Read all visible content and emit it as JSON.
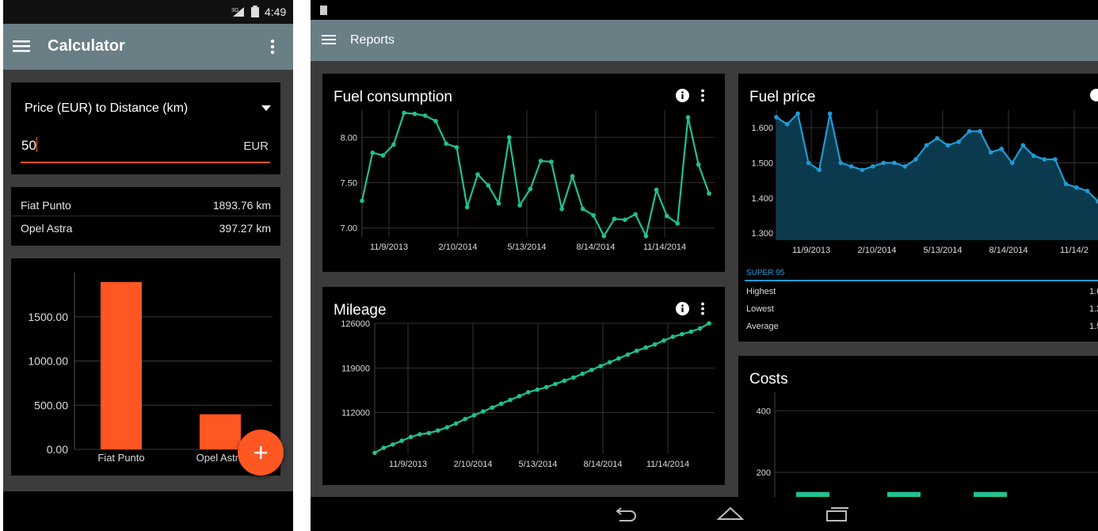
{
  "phone": {
    "status": {
      "network": "3G",
      "time": "4:49"
    },
    "appbar": {
      "title": "Calculator"
    },
    "converter": {
      "mode": "Price (EUR) to Distance (km)",
      "input_value": "50",
      "unit": "EUR"
    },
    "results": [
      {
        "name": "Fiat Punto",
        "value": "1893.76 km"
      },
      {
        "name": "Opel Astra",
        "value": "397.27 km"
      }
    ],
    "fab_icon": "plus-icon"
  },
  "chart_data": [
    {
      "type": "bar",
      "categories": [
        "Fiat Punto",
        "Opel Astra"
      ],
      "values": [
        1893.76,
        397.27
      ],
      "ylim": [
        0,
        2000
      ],
      "yticks": [
        "0.00",
        "500.00",
        "1000.00",
        "1500.00"
      ],
      "color": "#ff5722"
    },
    {
      "title": "Fuel consumption",
      "type": "line",
      "x_tick_labels": [
        "11/9/2013",
        "2/10/2014",
        "5/13/2014",
        "8/14/2014",
        "11/14/2014"
      ],
      "yticks": [
        "7.00",
        "7.50",
        "8.00"
      ],
      "ylim": [
        6.9,
        8.3
      ],
      "values": [
        7.3,
        7.83,
        7.8,
        7.92,
        8.27,
        8.26,
        8.24,
        8.18,
        7.93,
        7.89,
        7.23,
        7.59,
        7.47,
        7.27,
        8.0,
        7.25,
        7.43,
        7.74,
        7.73,
        7.21,
        7.57,
        7.21,
        7.14,
        6.91,
        7.1,
        7.09,
        7.15,
        6.91,
        7.42,
        7.13,
        7.05,
        8.22,
        7.7,
        7.38
      ],
      "color": "#1ec290"
    },
    {
      "title": "Mileage",
      "type": "line",
      "x_tick_labels": [
        "11/9/2013",
        "2/10/2014",
        "5/13/2014",
        "8/14/2014",
        "11/14/2014"
      ],
      "yticks": [
        "112000",
        "119000",
        "126000"
      ],
      "ylim": [
        105500,
        126000
      ],
      "values": [
        105700,
        106500,
        107000,
        107600,
        108200,
        108600,
        108800,
        109200,
        109700,
        110300,
        111000,
        111600,
        112200,
        112800,
        113400,
        114000,
        114600,
        115200,
        115600,
        116000,
        116500,
        117000,
        117500,
        118100,
        118700,
        119300,
        119900,
        120500,
        121100,
        121700,
        122200,
        122700,
        123300,
        123900,
        124300,
        124700,
        125200,
        126000
      ],
      "color": "#1ec290"
    },
    {
      "title": "Fuel price",
      "type": "area",
      "x_tick_labels": [
        "11/9/2013",
        "2/10/2014",
        "5/13/2014",
        "8/14/2014",
        "11/14/2"
      ],
      "yticks": [
        "1.300",
        "1.400",
        "1.500",
        "1.600"
      ],
      "ylim": [
        1.28,
        1.65
      ],
      "values": [
        1.63,
        1.61,
        1.64,
        1.5,
        1.48,
        1.64,
        1.5,
        1.49,
        1.48,
        1.49,
        1.5,
        1.5,
        1.49,
        1.51,
        1.55,
        1.57,
        1.55,
        1.56,
        1.59,
        1.59,
        1.53,
        1.54,
        1.5,
        1.55,
        1.52,
        1.51,
        1.51,
        1.44,
        1.43,
        1.42,
        1.39
      ],
      "color": "#1e9bd7"
    },
    {
      "title": "Costs",
      "type": "bar",
      "yticks": [
        "200",
        "400"
      ],
      "ylim": [
        120,
        460
      ],
      "values": [
        136,
        136,
        136
      ],
      "color": "#1ec290"
    }
  ],
  "tablet": {
    "appbar": {
      "title": "Reports"
    },
    "fuel_price_stats": {
      "fuel_type": "SUPER 95",
      "rows": [
        {
          "label": "Highest",
          "value": "1.6"
        },
        {
          "label": "Lowest",
          "value": "1.2"
        },
        {
          "label": "Average",
          "value": "1.5"
        }
      ]
    },
    "nav_icons": [
      "back-icon",
      "home-icon",
      "recents-icon"
    ]
  }
}
